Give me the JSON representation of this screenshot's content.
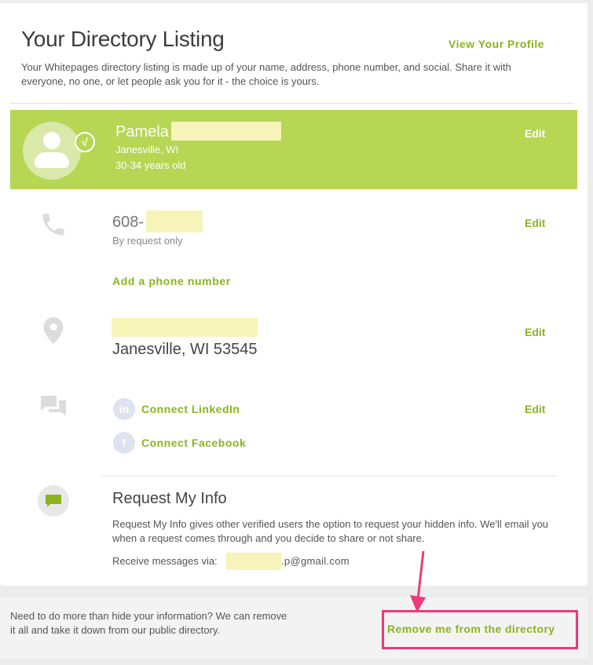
{
  "header": {
    "title": "Your Directory Listing",
    "view_profile_label": "View Your Profile",
    "intro": "Your Whitepages directory listing is made up of your name, address, phone number, and social. Share it with everyone, no one, or let people ask you for it - the choice is yours."
  },
  "profile": {
    "first_name": "Pamela",
    "location": "Janesville, WI",
    "age_range": "30-34 years old",
    "edit_label": "Edit",
    "verified_mark": "√"
  },
  "phone": {
    "number_prefix": "608-",
    "visibility": "By request only",
    "edit_label": "Edit",
    "add_label": "Add a phone number"
  },
  "address": {
    "city_line": "Janesville, WI 53545",
    "edit_label": "Edit"
  },
  "social": {
    "linkedin_label": "Connect LinkedIn",
    "linkedin_glyph": "in",
    "facebook_label": "Connect Facebook",
    "facebook_glyph": "f",
    "edit_label": "Edit"
  },
  "request_info": {
    "title": "Request My Info",
    "description": "Request My Info gives other verified users the option to request your hidden info. We'll email you when a request comes through and you decide to share or not share.",
    "receive_label": "Receive messages via:",
    "email_suffix": ".p@gmail.com"
  },
  "footer": {
    "text": "Need to do more than hide your information? We can remove it all and take it down from our public directory.",
    "remove_label": "Remove me from the directory"
  },
  "colors": {
    "accent_green": "#8bb41f",
    "band_green": "#b6d654",
    "highlight_pink": "#ec3b7c",
    "redaction": "#f7f4b9"
  }
}
